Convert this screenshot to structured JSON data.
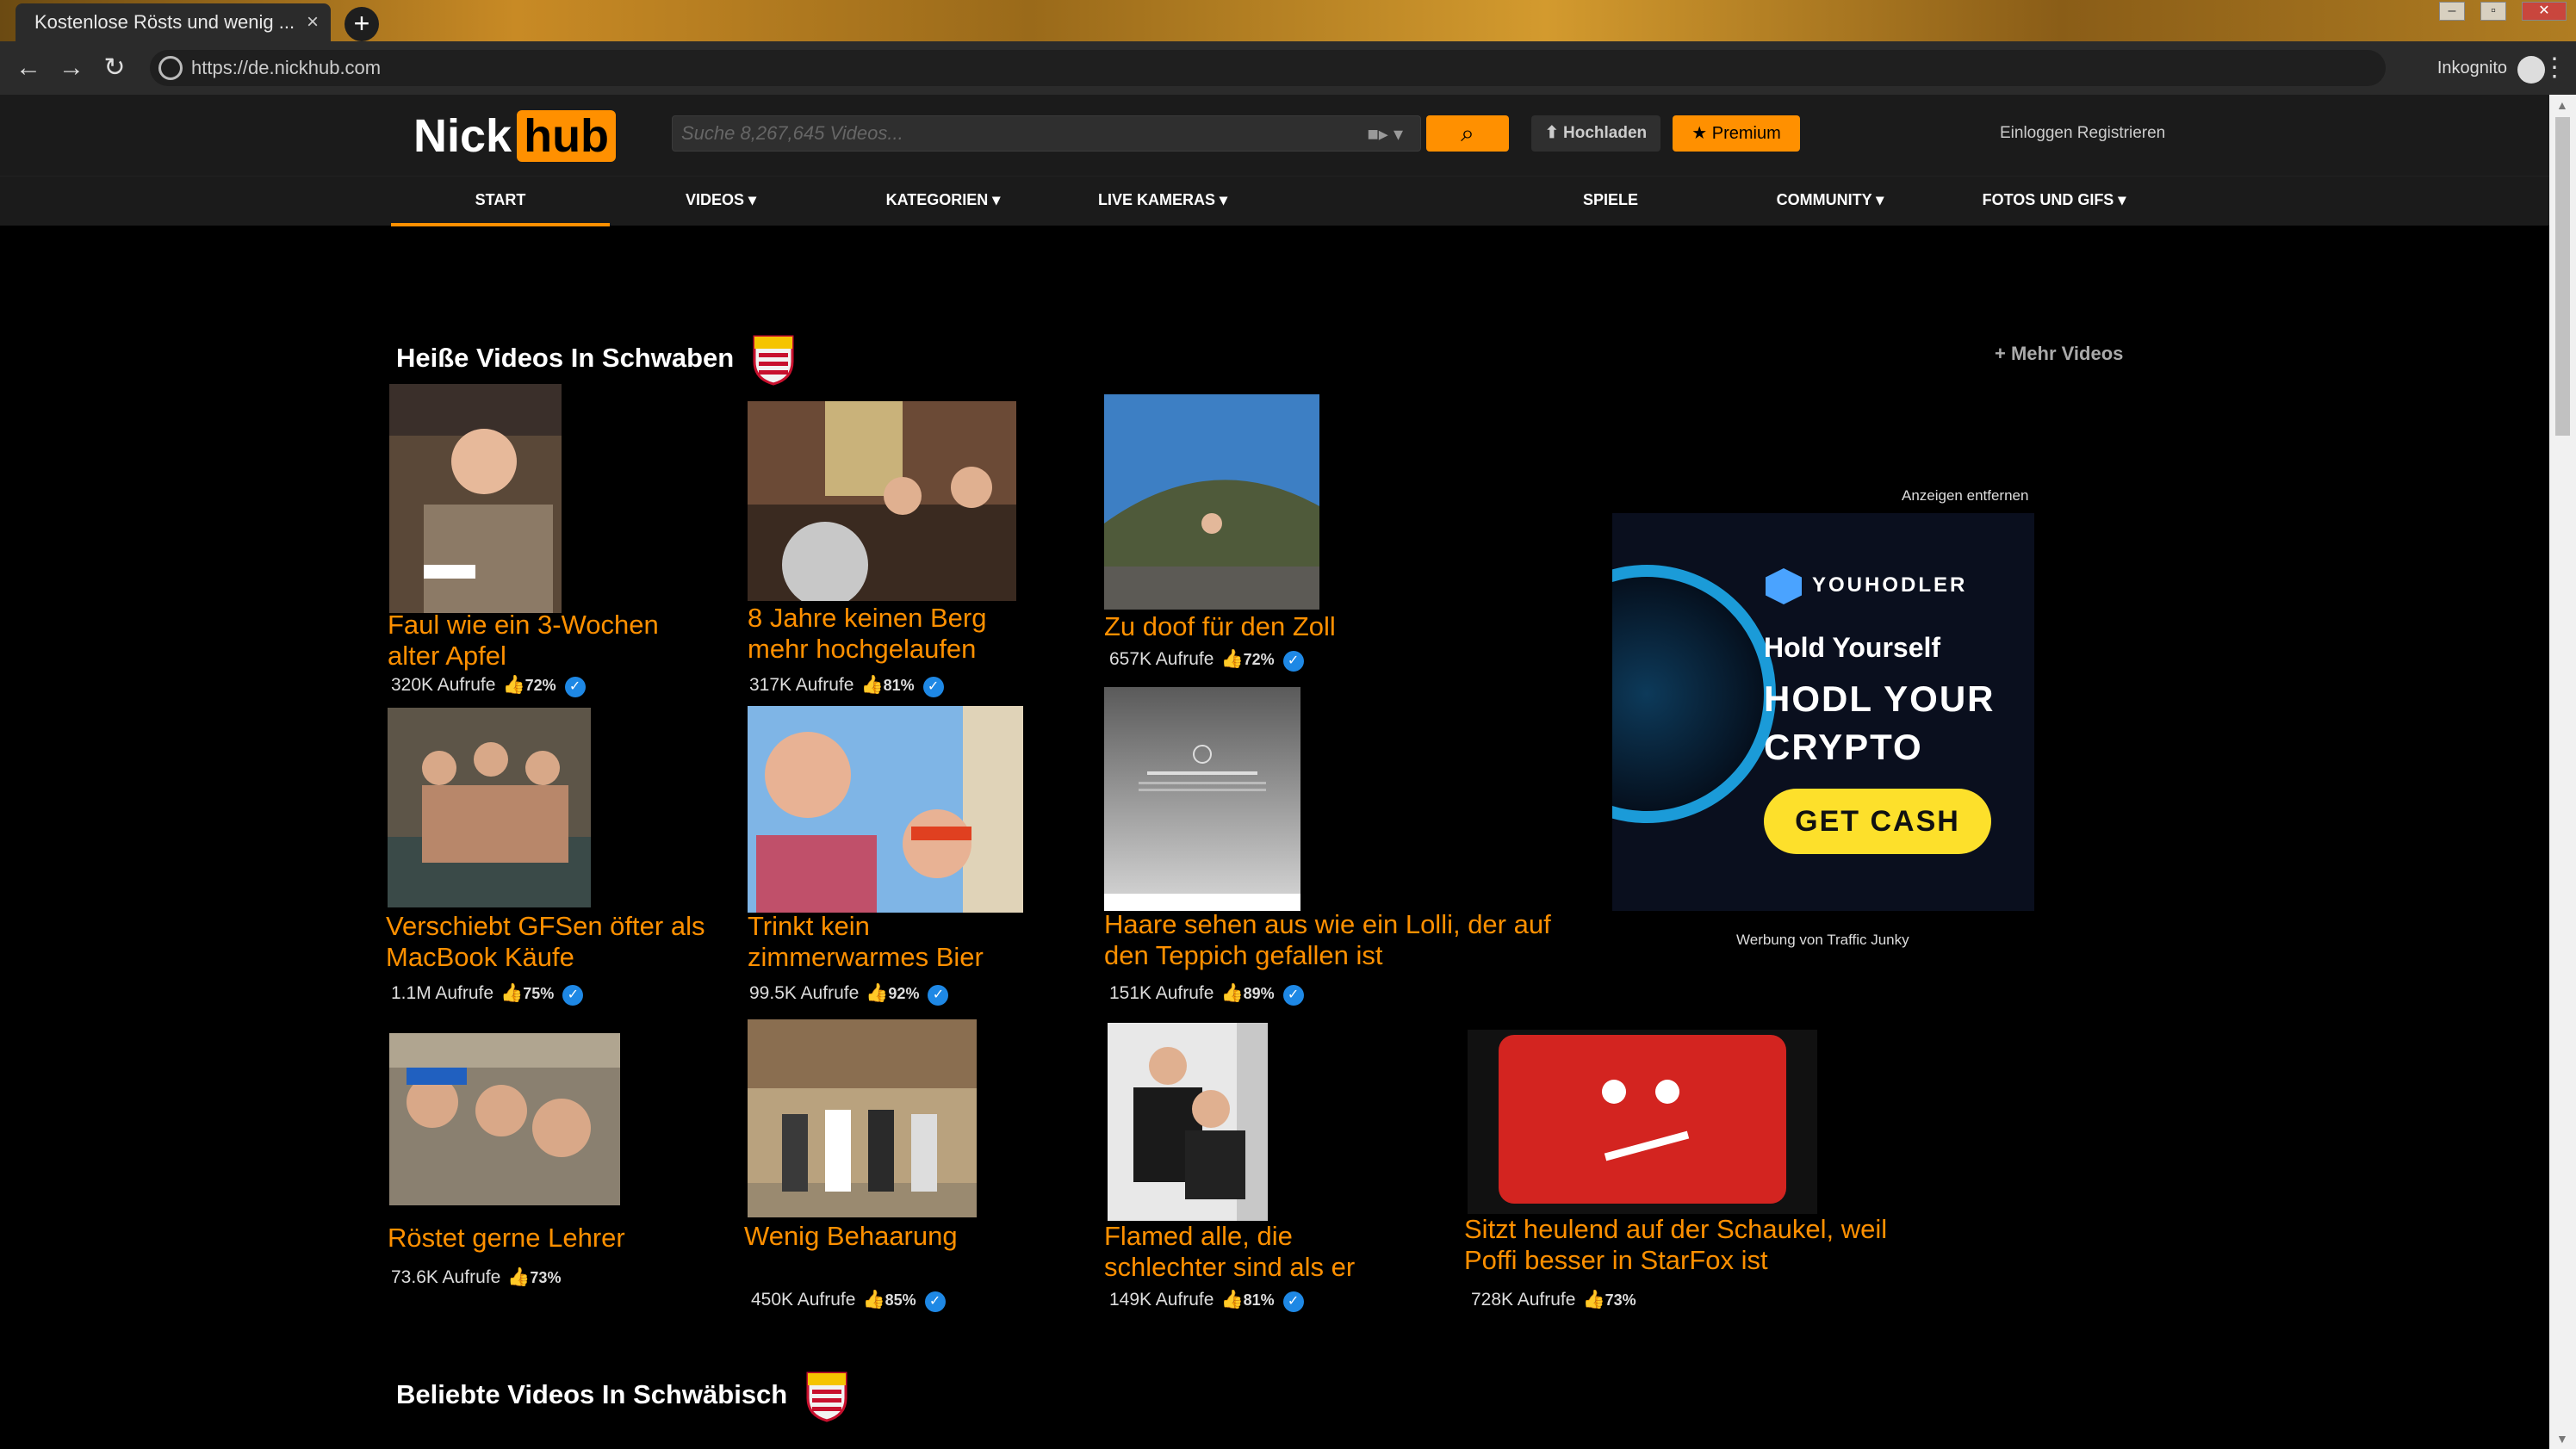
{
  "browser": {
    "tab_title": "Kostenlose Rösts und wenig ...",
    "tab_close": "×",
    "new_tab": "+",
    "url": "https://de.nickhub.com",
    "incognito_label": "Inkognito",
    "menu": "⋮"
  },
  "header": {
    "logo_nick": "Nick",
    "logo_hub": "hub",
    "search_placeholder": "Suche 8,267,645 Videos...",
    "upload_label": "Hochladen",
    "premium_label": "Premium",
    "auth_label": "Einloggen Registrieren"
  },
  "nav": {
    "items": [
      {
        "label": "START"
      },
      {
        "label": "VIDEOS ▾"
      },
      {
        "label": "KATEGORIEN ▾"
      },
      {
        "label": "LIVE KAMERAS ▾"
      },
      {
        "label": "SPIELE"
      },
      {
        "label": "COMMUNITY ▾"
      },
      {
        "label": "FOTOS UND GIFS ▾"
      }
    ]
  },
  "section": {
    "title": "Heiße Videos In Schwaben",
    "more": "+ Mehr Videos",
    "title2": "Beliebte Videos In Schwäbisch"
  },
  "videos": [
    {
      "title": "Faul wie ein 3-Wochen alter Apfel",
      "views": "320K Aufrufe",
      "rating": "72%"
    },
    {
      "title": "8 Jahre keinen Berg mehr hochgelaufen",
      "views": "317K Aufrufe",
      "rating": "81%"
    },
    {
      "title": "Zu doof für den Zoll",
      "views": "657K Aufrufe",
      "rating": "72%"
    },
    {
      "title": "Verschiebt GFSen öfter als MacBook Käufe",
      "views": "1.1M Aufrufe",
      "rating": "75%"
    },
    {
      "title": "Trinkt kein zimmerwarmes Bier",
      "views": "99.5K Aufrufe",
      "rating": "92%"
    },
    {
      "title": "Haare sehen aus wie ein Lolli, der auf den Teppich gefallen ist",
      "views": "151K Aufrufe",
      "rating": "89%"
    },
    {
      "title": "Röstet gerne Lehrer",
      "views": "73.6K Aufrufe",
      "rating": "73%"
    },
    {
      "title": "Wenig Behaarung",
      "views": "450K Aufrufe",
      "rating": "85%"
    },
    {
      "title": "Flamed alle, die schlechter sind als er",
      "views": "149K Aufrufe",
      "rating": "81%"
    },
    {
      "title": "Sitzt heulend auf der Schaukel, weil Poffi besser in StarFox ist",
      "views": "728K Aufrufe",
      "rating": "73%"
    }
  ],
  "ad": {
    "remove_label": "Anzeigen entfernen",
    "brand": "YOUHODLER",
    "line1": "Hold Yourself",
    "line2": "HODL YOUR CRYPTO",
    "cta": "GET CASH",
    "credit": "Werbung von Traffic Junky"
  },
  "colors": {
    "accent": "#ff9000",
    "background": "#000000",
    "header": "#1b1b1b"
  }
}
